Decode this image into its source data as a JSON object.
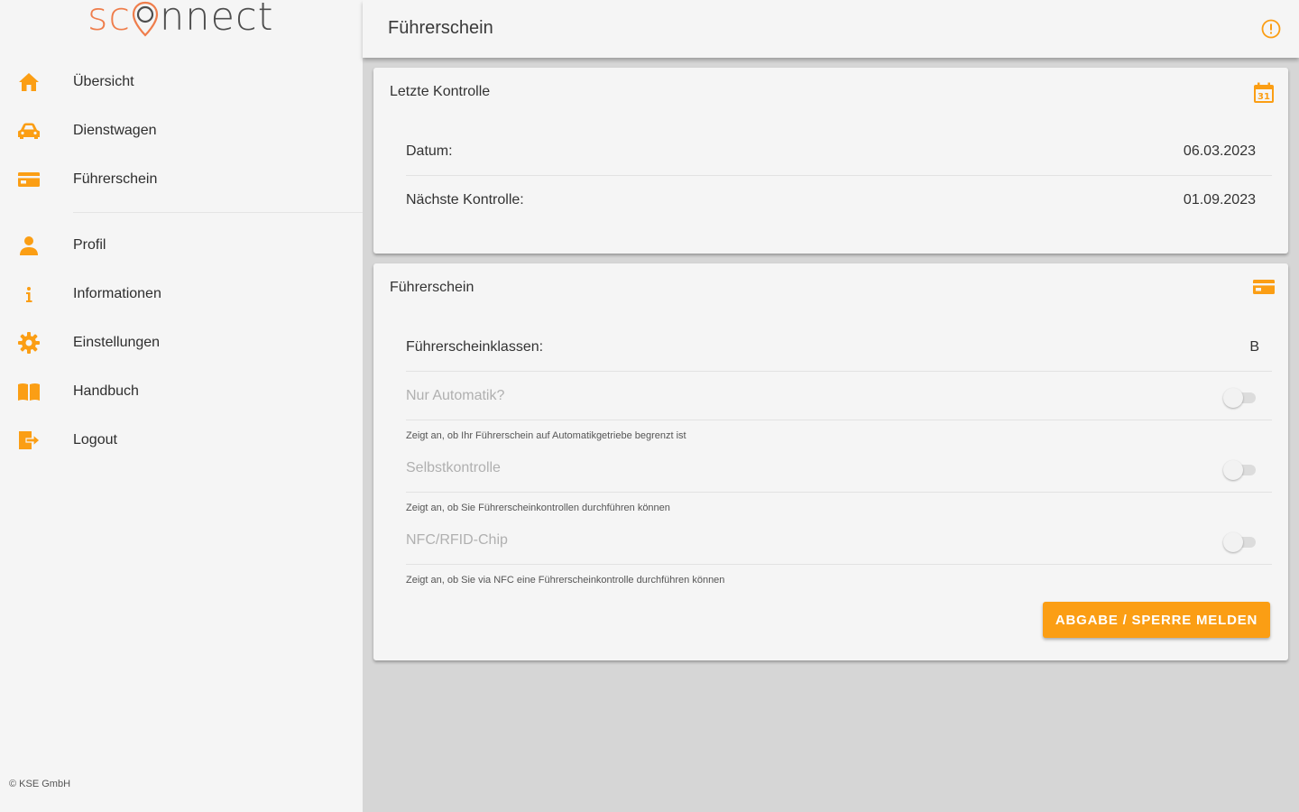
{
  "logo": {
    "left": "sc",
    "pin_letter": "o",
    "right": "nnect"
  },
  "colors": {
    "accent": "#fb9e14",
    "logo_orange": "#ef7d4b",
    "logo_gray": "#4e4e4e"
  },
  "sidebar": {
    "items_top": [
      {
        "label": "Übersicht",
        "icon": "home-icon"
      },
      {
        "label": "Dienstwagen",
        "icon": "car-icon"
      },
      {
        "label": "Führerschein",
        "icon": "license-card-icon"
      }
    ],
    "items_bottom": [
      {
        "label": "Profil",
        "icon": "person-icon"
      },
      {
        "label": "Informationen",
        "icon": "info-icon"
      },
      {
        "label": "Einstellungen",
        "icon": "gear-icon"
      },
      {
        "label": "Handbuch",
        "icon": "book-icon"
      },
      {
        "label": "Logout",
        "icon": "logout-icon"
      }
    ],
    "footer": "© KSE GmbH"
  },
  "header": {
    "title": "Führerschein",
    "info_icon": "info-circle-icon"
  },
  "card_control": {
    "title": "Letzte Kontrolle",
    "icon": "calendar-icon",
    "calendar_text": "31",
    "rows": [
      {
        "label": "Datum:",
        "value": "06.03.2023"
      },
      {
        "label": "Nächste Kontrolle:",
        "value": "01.09.2023"
      }
    ]
  },
  "card_license": {
    "title": "Führerschein",
    "icon": "license-card-icon",
    "classes_label": "Führerscheinklassen:",
    "classes_value": "B",
    "toggles": [
      {
        "label": "Nur Automatik?",
        "hint": "Zeigt an, ob Ihr Führerschein auf Automatikgetriebe begrenzt ist",
        "checked": false
      },
      {
        "label": "Selbstkontrolle",
        "hint": "Zeigt an, ob Sie Führerscheinkontrollen durchführen können",
        "checked": false
      },
      {
        "label": "NFC/RFID-Chip",
        "hint": "Zeigt an, ob Sie via NFC eine Führerscheinkontrolle durchführen können",
        "checked": false
      }
    ],
    "button_label": "ABGABE / SPERRE MELDEN"
  }
}
